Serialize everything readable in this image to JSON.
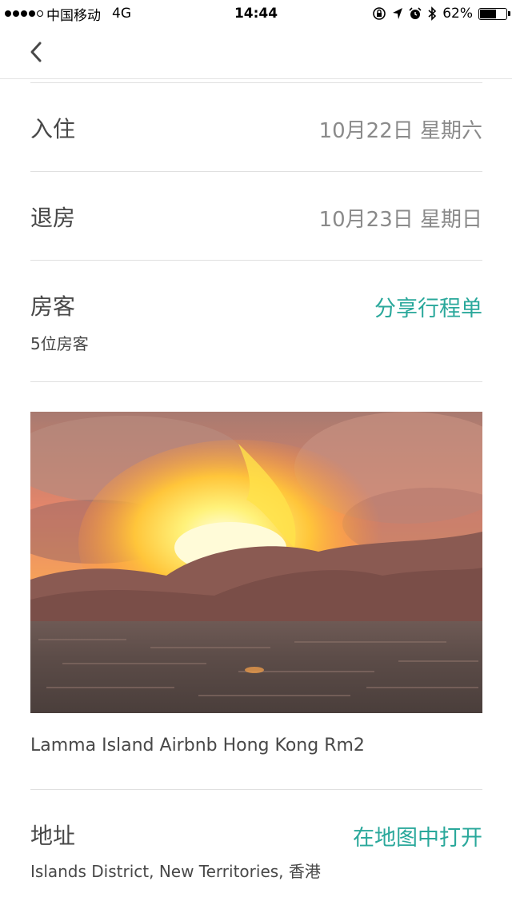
{
  "status_bar": {
    "carrier": "中国移动",
    "network": "4G",
    "time": "14:44",
    "battery_percent": "62%",
    "battery_level": 0.62,
    "icons": [
      "signal-dots-icon",
      "lock-rotation-icon",
      "location-arrow-icon",
      "alarm-icon",
      "bluetooth-icon",
      "battery-icon"
    ]
  },
  "nav": {
    "back_icon": "chevron-left-icon"
  },
  "checkin": {
    "label": "入住",
    "value": "10月22日 星期六"
  },
  "checkout": {
    "label": "退房",
    "value": "10月23日 星期日"
  },
  "guests": {
    "label": "房客",
    "count": "5位房客",
    "share_link": "分享行程单"
  },
  "listing": {
    "title": "Lamma Island Airbnb Hong Kong Rm2"
  },
  "address": {
    "label": "地址",
    "value": "Islands District, New Territories, 香港",
    "map_link": "在地图中打开"
  },
  "colors": {
    "accent": "#2aa89b",
    "text": "#484848",
    "muted": "#8a8a8a",
    "divider": "#e0e0e0"
  }
}
